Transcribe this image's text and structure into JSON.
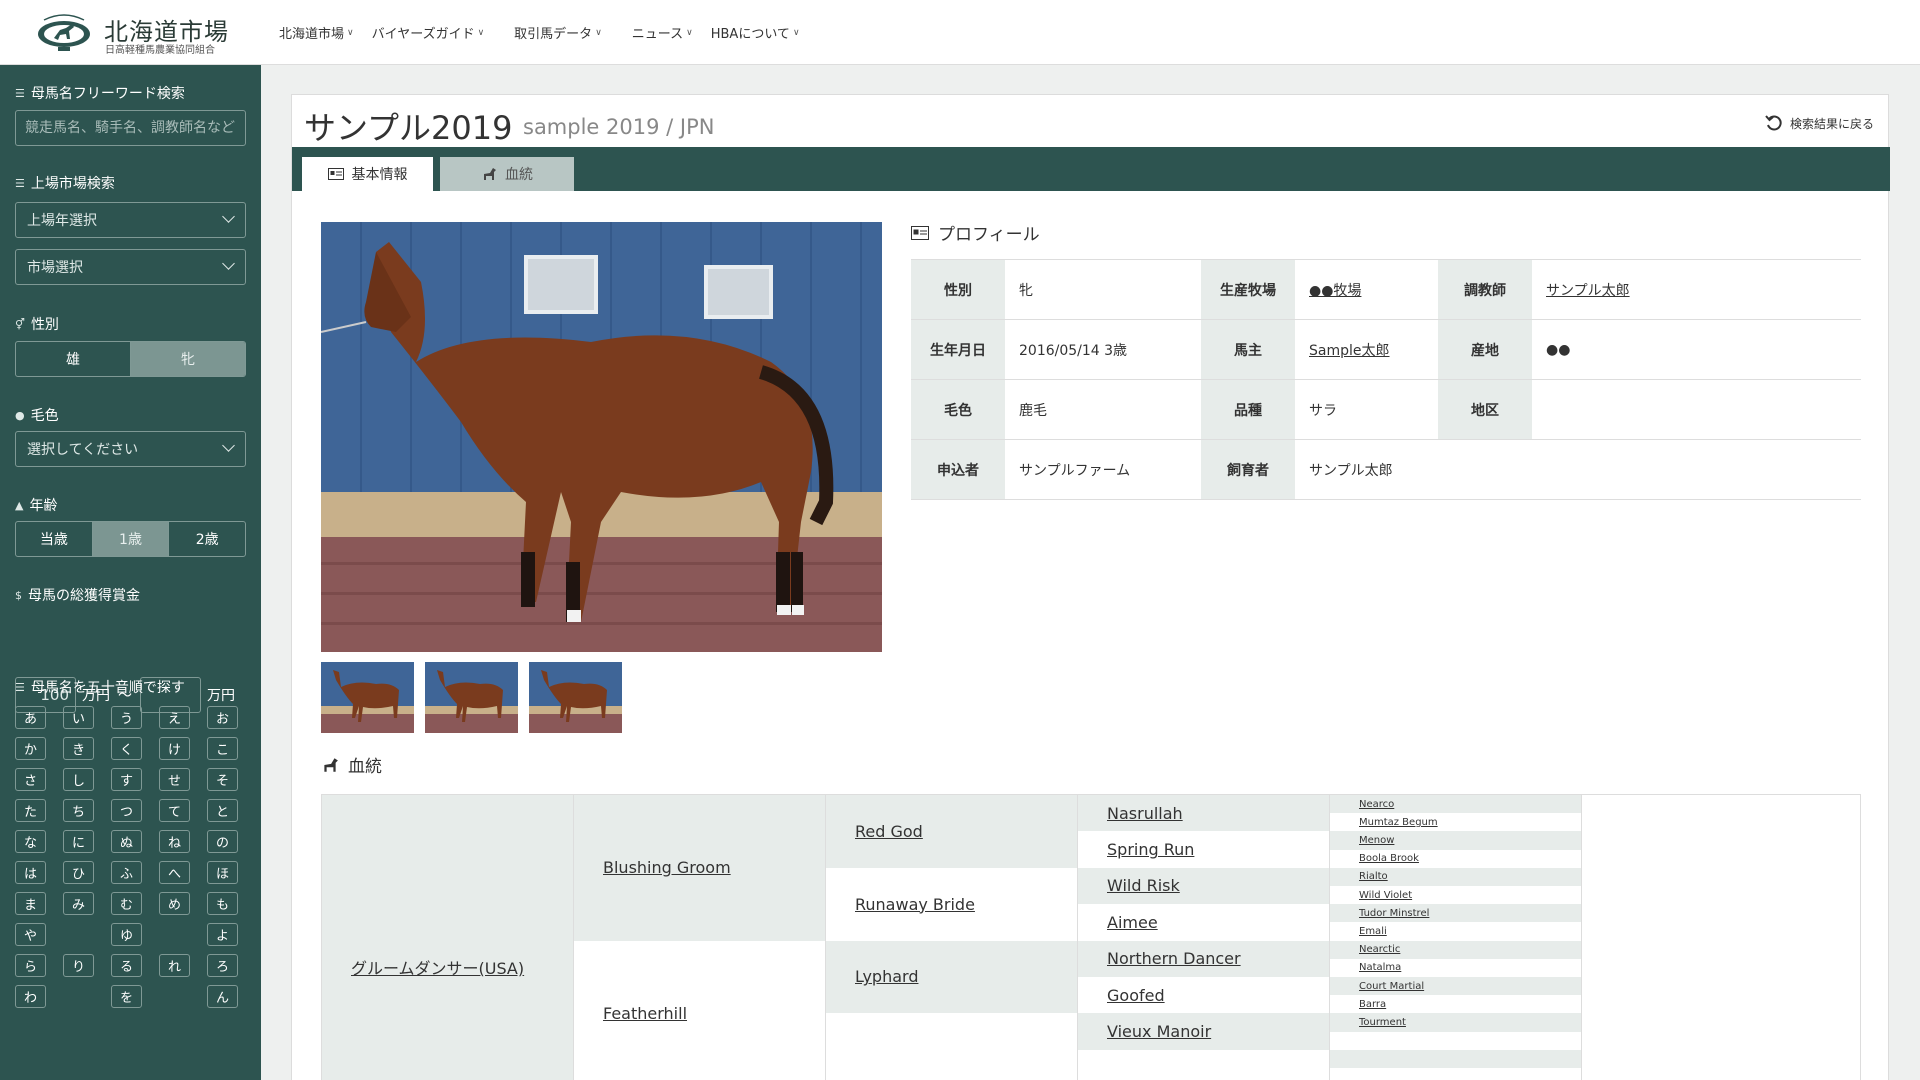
{
  "header": {
    "logo_title": "北海道市場",
    "logo_sub": "日高軽種馬農業協同組合",
    "nav": [
      "北海道市場",
      "バイヤーズガイド",
      "取引馬データ",
      "ニュース",
      "HBAについて"
    ]
  },
  "sidebar": {
    "freeword_label": "母馬名フリーワード検索",
    "freeword_placeholder": "競走馬名、騎手名、調教師名など",
    "market_label": "上場市場検索",
    "year_select": "上場年選択",
    "market_select": "市場選択",
    "sex_label": "性別",
    "sex_options": [
      "雄",
      "牝"
    ],
    "sex_selected": "牝",
    "color_label": "毛色",
    "color_select": "選択してください",
    "age_label": "年齢",
    "age_options": [
      "当歳",
      "1歳",
      "2歳"
    ],
    "age_selected": "1歳",
    "prize_label": "母馬の総獲得賞金",
    "prize_min": "100",
    "prize_max": "",
    "prize_unit": "万円",
    "prize_sep": "〜",
    "kana_label": "母馬名を五十音順で探す",
    "kana": [
      "あ",
      "い",
      "う",
      "え",
      "お",
      "か",
      "き",
      "く",
      "け",
      "こ",
      "さ",
      "し",
      "す",
      "せ",
      "そ",
      "た",
      "ち",
      "つ",
      "て",
      "と",
      "な",
      "に",
      "ぬ",
      "ね",
      "の",
      "は",
      "ひ",
      "ふ",
      "へ",
      "ほ",
      "ま",
      "み",
      "む",
      "め",
      "も",
      "や",
      "",
      "ゆ",
      "",
      "よ",
      "ら",
      "り",
      "る",
      "れ",
      "ろ",
      "わ",
      "",
      "を",
      "",
      "ん"
    ]
  },
  "horse": {
    "name": "サンプル2019",
    "sub": "sample 2019 / JPN",
    "back_label": "検索結果に戻る"
  },
  "tabs": {
    "basic": "基本情報",
    "pedigree": "血統"
  },
  "profile": {
    "title": "プロフィール",
    "rows": [
      [
        {
          "h": "性別",
          "v": "牝",
          "link": false
        },
        {
          "h": "生産牧場",
          "v": "●●牧場",
          "link": true
        },
        {
          "h": "調教師",
          "v": "サンプル太郎",
          "link": true
        }
      ],
      [
        {
          "h": "生年月日",
          "v": "2016/05/14 3歳",
          "link": false
        },
        {
          "h": "馬主",
          "v": "Sample太郎",
          "link": true
        },
        {
          "h": "産地",
          "v": "●●",
          "link": false
        }
      ],
      [
        {
          "h": "毛色",
          "v": "鹿毛",
          "link": false
        },
        {
          "h": "品種",
          "v": "サラ",
          "link": false
        },
        {
          "h": "地区",
          "v": "",
          "link": false
        }
      ],
      [
        {
          "h": "申込者",
          "v": "サンプルファーム",
          "link": false
        },
        {
          "h": "飼育者",
          "v": "サンプル太郎",
          "link": false
        }
      ]
    ]
  },
  "pedigree": {
    "title": "血統",
    "g1": "グルームダンサー(USA)",
    "g2": [
      "Blushing Groom",
      "Featherhill"
    ],
    "g3": [
      "Red God",
      "Runaway Bride",
      "Lyphard",
      ""
    ],
    "g4": [
      "Nasrullah",
      "Spring Run",
      "Wild Risk",
      "Aimee",
      "Northern Dancer",
      "Goofed",
      "Vieux Manoir",
      ""
    ],
    "g5": [
      "Nearco",
      "Mumtaz Begum",
      "Menow",
      "Boola Brook",
      "Rialto",
      "Wild Violet",
      "Tudor Minstrel",
      "Emali",
      "Nearctic",
      "Natalma",
      "Court Martial",
      "Barra",
      "Tourment",
      "",
      "",
      ""
    ]
  }
}
